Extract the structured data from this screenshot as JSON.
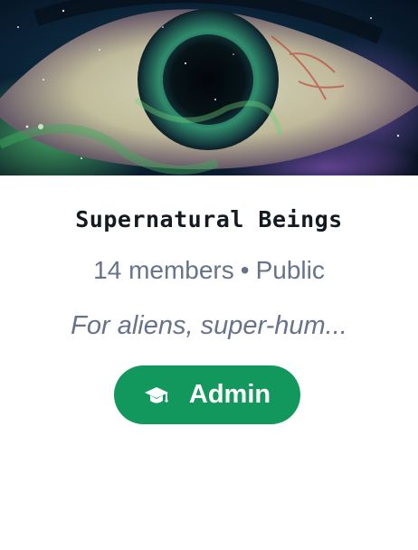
{
  "group": {
    "cover_image": "cosmic-eye-cover",
    "name": "Supernatural Beings",
    "member_count": "14 members",
    "separator": "•",
    "visibility": "Public",
    "description": "For aliens, super-hum..."
  },
  "role_button": {
    "label": "Admin",
    "icon": "graduation-cap-icon",
    "color": "#12985c"
  },
  "colors": {
    "title": "#141a22",
    "meta": "#66738a"
  }
}
